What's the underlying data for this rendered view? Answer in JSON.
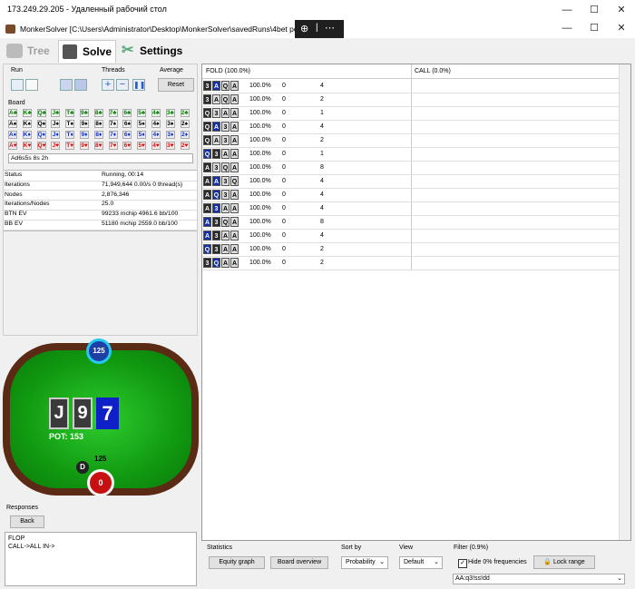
{
  "rdp": {
    "title": "173.249.29.205 - Удаленный рабочий стол"
  },
  "app": {
    "title": "MonkerSolver [C:\\Users\\Administrator\\Desktop\\MonkerSolver\\savedRuns\\4bet pots\\cob"
  },
  "tabs": [
    {
      "label": "Tree"
    },
    {
      "label": "Solve"
    },
    {
      "label": "Settings"
    }
  ],
  "run": {
    "label": "Run"
  },
  "threads": {
    "label": "Threads"
  },
  "average": {
    "label": "Average",
    "reset": "Reset"
  },
  "board": {
    "label": "Board",
    "rows": [
      [
        "A♣",
        "K♣",
        "Q♣",
        "J♣",
        "T♣",
        "9♣",
        "8♣",
        "7♣",
        "6♣",
        "5♣",
        "4♣",
        "3♣",
        "2♣"
      ],
      [
        "A♠",
        "K♠",
        "Q♠",
        "J♠",
        "T♠",
        "9♠",
        "8♠",
        "7♠",
        "6♠",
        "5♠",
        "4♠",
        "3♠",
        "2♠"
      ],
      [
        "A♦",
        "K♦",
        "Q♦",
        "J♦",
        "T♦",
        "9♦",
        "8♦",
        "7♦",
        "6♦",
        "5♦",
        "4♦",
        "3♦",
        "2♦"
      ],
      [
        "A♥",
        "K♥",
        "Q♥",
        "J♥",
        "T♥",
        "9♥",
        "8♥",
        "7♥",
        "6♥",
        "5♥",
        "4♥",
        "3♥",
        "2♥"
      ]
    ],
    "text": "Ad6s5s 8s 2h"
  },
  "stats": [
    {
      "k": "Status",
      "v": "Running, 00:14"
    },
    {
      "k": "Iterations",
      "v": "71,949,644  0.00/s 0 thread(s)"
    },
    {
      "k": "Nodes",
      "v": "2,876,346"
    },
    {
      "k": "Iterations/Nodes",
      "v": "25.0"
    },
    {
      "k": "BTN EV",
      "v": "99233 mchip   4961.6 bb/100"
    },
    {
      "k": "BB EV",
      "v": "51180 mchip   2559.0 bb/100"
    }
  ],
  "table_view": {
    "top_chip": "125",
    "board_cards": [
      "J",
      "9",
      "7"
    ],
    "pot": "POT: 153",
    "dealer": "D",
    "bottom_stack": "125",
    "bottom_chip": "0"
  },
  "responses": {
    "label": "Responses",
    "back": "Back",
    "lines": [
      "FLOP",
      "CALL->ALL IN->"
    ]
  },
  "grid": {
    "headers": [
      "FOLD (100.0%)",
      "CALL (0.0%)"
    ],
    "colors": {
      "d": "#2a2a2a",
      "b": "#1030b0",
      "g": "#dcdcdc"
    },
    "rows": [
      {
        "hand": [
          [
            "3",
            "d"
          ],
          [
            "A",
            "b"
          ],
          [
            "Q",
            "g"
          ],
          [
            "A",
            "g"
          ]
        ],
        "pct": "100.0%",
        "a": "0",
        "b": "4"
      },
      {
        "hand": [
          [
            "3",
            "d"
          ],
          [
            "A",
            "g"
          ],
          [
            "Q",
            "g"
          ],
          [
            "A",
            "g"
          ]
        ],
        "pct": "100.0%",
        "a": "0",
        "b": "2"
      },
      {
        "hand": [
          [
            "Q",
            "d"
          ],
          [
            "3",
            "g"
          ],
          [
            "A",
            "g"
          ],
          [
            "A",
            "g"
          ]
        ],
        "pct": "100.0%",
        "a": "0",
        "b": "1"
      },
      {
        "hand": [
          [
            "Q",
            "d"
          ],
          [
            "A",
            "b"
          ],
          [
            "3",
            "g"
          ],
          [
            "A",
            "g"
          ]
        ],
        "pct": "100.0%",
        "a": "0",
        "b": "4"
      },
      {
        "hand": [
          [
            "Q",
            "d"
          ],
          [
            "A",
            "g"
          ],
          [
            "3",
            "g"
          ],
          [
            "A",
            "g"
          ]
        ],
        "pct": "100.0%",
        "a": "0",
        "b": "2"
      },
      {
        "hand": [
          [
            "Q",
            "b"
          ],
          [
            "3",
            "d"
          ],
          [
            "A",
            "g"
          ],
          [
            "A",
            "g"
          ]
        ],
        "pct": "100.0%",
        "a": "0",
        "b": "1"
      },
      {
        "hand": [
          [
            "A",
            "d"
          ],
          [
            "3",
            "g"
          ],
          [
            "Q",
            "g"
          ],
          [
            "A",
            "g"
          ]
        ],
        "pct": "100.0%",
        "a": "0",
        "b": "8"
      },
      {
        "hand": [
          [
            "A",
            "d"
          ],
          [
            "A",
            "b"
          ],
          [
            "3",
            "g"
          ],
          [
            "Q",
            "g"
          ]
        ],
        "pct": "100.0%",
        "a": "0",
        "b": "4"
      },
      {
        "hand": [
          [
            "A",
            "d"
          ],
          [
            "Q",
            "b"
          ],
          [
            "3",
            "g"
          ],
          [
            "A",
            "g"
          ]
        ],
        "pct": "100.0%",
        "a": "0",
        "b": "4"
      },
      {
        "hand": [
          [
            "A",
            "d"
          ],
          [
            "3",
            "b"
          ],
          [
            "A",
            "g"
          ],
          [
            "A",
            "g"
          ]
        ],
        "pct": "100.0%",
        "a": "0",
        "b": "4"
      },
      {
        "hand": [
          [
            "A",
            "b"
          ],
          [
            "3",
            "d"
          ],
          [
            "Q",
            "g"
          ],
          [
            "A",
            "g"
          ]
        ],
        "pct": "100.0%",
        "a": "0",
        "b": "8"
      },
      {
        "hand": [
          [
            "A",
            "b"
          ],
          [
            "3",
            "d"
          ],
          [
            "A",
            "g"
          ],
          [
            "A",
            "g"
          ]
        ],
        "pct": "100.0%",
        "a": "0",
        "b": "4"
      },
      {
        "hand": [
          [
            "Q",
            "b"
          ],
          [
            "3",
            "d"
          ],
          [
            "A",
            "g"
          ],
          [
            "A",
            "g"
          ]
        ],
        "pct": "100.0%",
        "a": "0",
        "b": "2"
      },
      {
        "hand": [
          [
            "3",
            "d"
          ],
          [
            "Q",
            "b"
          ],
          [
            "A",
            "g"
          ],
          [
            "A",
            "g"
          ]
        ],
        "pct": "100.0%",
        "a": "0",
        "b": "2"
      }
    ]
  },
  "bottom": {
    "statistics": "Statistics",
    "equity_graph": "Equity graph",
    "board_overview": "Board overview",
    "sort_by": "Sort by",
    "sort_value": "Probability",
    "view": "View",
    "view_value": "Default",
    "filter": "Filter (0.9%)",
    "hide_zero": "Hide 0% frequencies",
    "lock_range": "Lock range",
    "filter_value": "AA:q3!ss!dd"
  }
}
